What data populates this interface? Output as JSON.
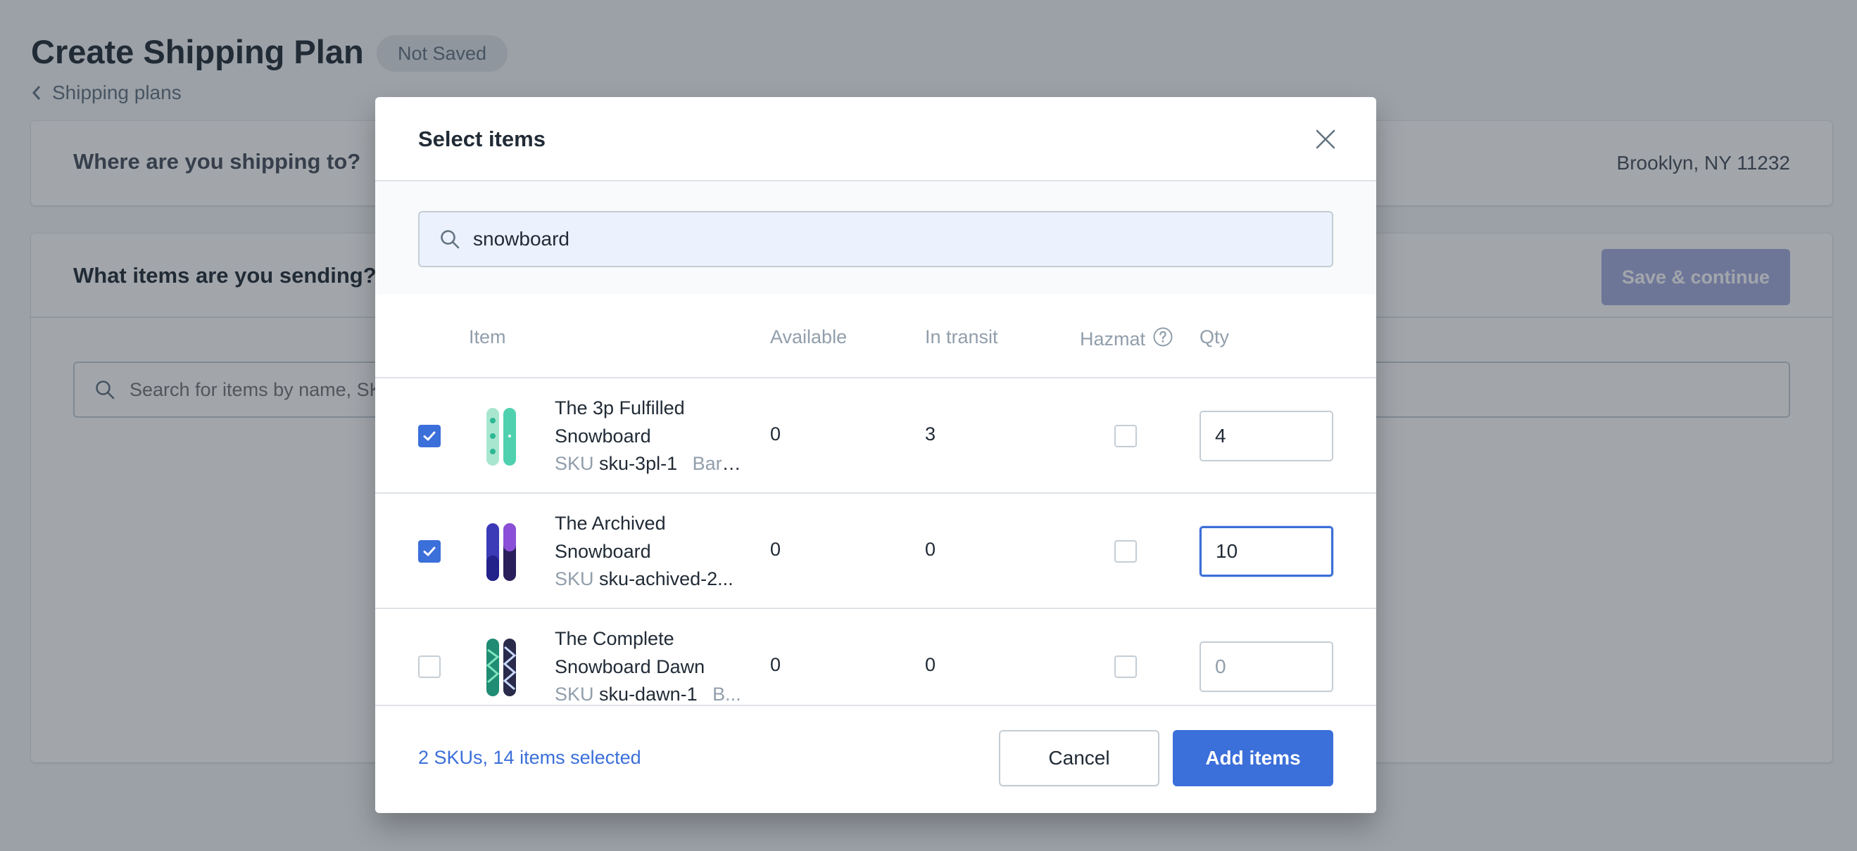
{
  "page": {
    "title": "Create Shipping Plan",
    "status": "Not Saved",
    "breadcrumb": "Shipping plans",
    "destination_question": "Where are you shipping to?",
    "destination_address": "Brooklyn, NY 11232",
    "items_question": "What items are you sending?",
    "save_label": "Save & continue",
    "search_placeholder": "Search for items by name, SKU, or barcode"
  },
  "modal": {
    "title": "Select items",
    "search_value": "snowboard",
    "columns": {
      "item": "Item",
      "available": "Available",
      "in_transit": "In transit",
      "hazmat": "Hazmat",
      "qty": "Qty"
    },
    "rows": [
      {
        "name": "The 3p Fulfilled Snowboard",
        "sku_label": "SKU",
        "sku": "sku-3pl-1",
        "extra": "Barc...",
        "available": "0",
        "in_transit": "3",
        "checked": true,
        "qty": "4",
        "qty_placeholder": "0"
      },
      {
        "name": "The Archived Snowboard",
        "sku_label": "SKU",
        "sku": "sku-achived-2...",
        "extra": "",
        "available": "0",
        "in_transit": "0",
        "checked": true,
        "qty": "10",
        "qty_placeholder": "0"
      },
      {
        "name": "The Complete Snowboard Dawn",
        "sku_label": "SKU",
        "sku": "sku-dawn-1",
        "extra": "B...",
        "available": "0",
        "in_transit": "0",
        "checked": false,
        "qty": "",
        "qty_placeholder": "0"
      }
    ],
    "summary": "2 SKUs, 14 items selected",
    "cancel_label": "Cancel",
    "add_label": "Add items"
  },
  "icons": {
    "close": "close-icon",
    "search": "search-icon",
    "help": "help-circle-icon",
    "check": "checkmark-icon",
    "back": "chevron-left-icon"
  },
  "colors": {
    "accent": "#3b6fd9",
    "search_bg": "#ebf1fd",
    "overlay": "#212b36"
  }
}
